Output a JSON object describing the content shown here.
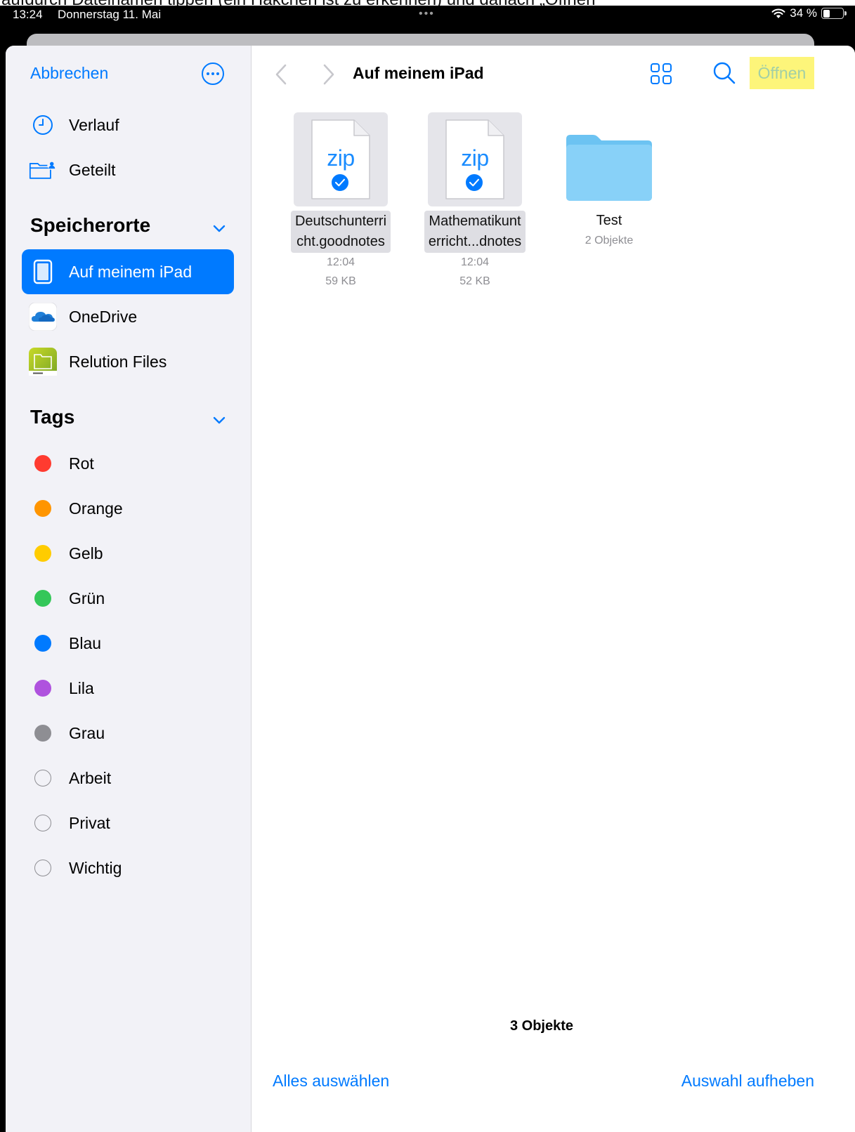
{
  "caption": "aufdurch Dateinamen tippen (ein Häkchen ist zu erkennen) und danach „Öffnen“",
  "status_bar": {
    "time": "13:24",
    "date": "Donnerstag 11. Mai",
    "dots": "•••",
    "battery": "34 %",
    "battery_level": 0.34
  },
  "sidebar": {
    "cancel": "Abbrechen",
    "more_icon": "ellipsis-circle-icon",
    "top_items": [
      {
        "label": "Verlauf",
        "icon": "clock-icon"
      },
      {
        "label": "Geteilt",
        "icon": "shared-folder-icon"
      }
    ],
    "locations_title": "Speicherorte",
    "locations": [
      {
        "label": "Auf meinem iPad",
        "icon": "ipad-icon",
        "active": true
      },
      {
        "label": "OneDrive",
        "icon": "onedrive-icon"
      },
      {
        "label": "Relution Files",
        "icon": "relution-icon"
      }
    ],
    "tags_title": "Tags",
    "tags": [
      {
        "label": "Rot",
        "color": "#ff3b30"
      },
      {
        "label": "Orange",
        "color": "#ff9500"
      },
      {
        "label": "Gelb",
        "color": "#ffcc00"
      },
      {
        "label": "Grün",
        "color": "#34c759"
      },
      {
        "label": "Blau",
        "color": "#007aff"
      },
      {
        "label": "Lila",
        "color": "#af52de"
      },
      {
        "label": "Grau",
        "color": "#8e8e93"
      },
      {
        "label": "Arbeit",
        "color": ""
      },
      {
        "label": "Privat",
        "color": ""
      },
      {
        "label": "Wichtig",
        "color": ""
      }
    ]
  },
  "main": {
    "title": "Auf meinem iPad",
    "open": "Öffnen",
    "files": [
      {
        "name_line1": "Deutschunterri",
        "name_line2": "cht.goodnotes",
        "icon_text": "zip",
        "time": "12:04",
        "size": "59 KB",
        "selected": true
      },
      {
        "name_line1": "Mathematikunt",
        "name_line2": "erricht...dnotes",
        "icon_text": "zip",
        "time": "12:04",
        "size": "52 KB",
        "selected": true
      }
    ],
    "folder": {
      "name": "Test",
      "count": "2 Objekte"
    },
    "item_count": "3 Objekte",
    "select_all": "Alles auswählen",
    "deselect": "Auswahl aufheben"
  },
  "colors": {
    "accent": "#007aff",
    "highlight": "#fdf57a",
    "sidebar_bg": "#f2f2f7"
  }
}
